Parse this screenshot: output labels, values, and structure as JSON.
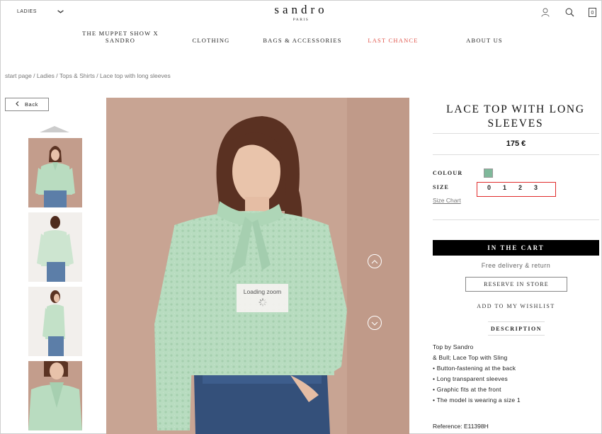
{
  "header": {
    "language_selector": "LADIES",
    "brand": "sandro",
    "brand_sub": "PARIS",
    "cart_count": "0"
  },
  "nav": [
    {
      "label_line1": "THE MUPPET SHOW X",
      "label_line2": "SANDRO",
      "highlight": false
    },
    {
      "label_line1": "CLOTHING",
      "label_line2": "",
      "highlight": false
    },
    {
      "label_line1": "BAGS & ACCESSORIES",
      "label_line2": "",
      "highlight": false
    },
    {
      "label_line1": "LAST CHANCE",
      "label_line2": "",
      "highlight": true
    },
    {
      "label_line1": "ABOUT US",
      "label_line2": "",
      "highlight": false
    }
  ],
  "breadcrumb": "start page / Ladies / Tops & Shirts / Lace top with long sleeves",
  "back_label": "Back",
  "gallery": {
    "loading_label": "Loading zoom"
  },
  "product": {
    "title": "LACE TOP WITH LONG SLEEVES",
    "price": "175 €",
    "colour_label": "COLOUR",
    "size_label": "SIZE",
    "sizes": [
      "0",
      "1",
      "2",
      "3"
    ],
    "size_chart": "Size Chart",
    "add_to_cart": "IN THE CART",
    "free_delivery": "Free delivery & return",
    "reserve": "RESERVE IN STORE",
    "wishlist": "ADD TO MY WISHLIST",
    "description_heading": "DESCRIPTION",
    "description_lines": [
      "Top by Sandro",
      "& Bull; Lace Top with Sling",
      "• Button-fastening at the back",
      "• Long transparent sleeves",
      "• Graphic fits at the front",
      "• The model is wearing a size 1"
    ],
    "reference": "Reference: E11398H"
  },
  "colors": {
    "accent_red": "#e0544a",
    "swatch": "#7fb89a",
    "cart_button": "#000000",
    "size_highlight_border": "#e02b2b"
  },
  "icons": [
    "chevron-down-icon",
    "user-icon",
    "search-icon",
    "cart-icon",
    "chevron-left-icon",
    "chevron-up-icon",
    "chevron-down-circle-icon",
    "spinner-icon"
  ]
}
